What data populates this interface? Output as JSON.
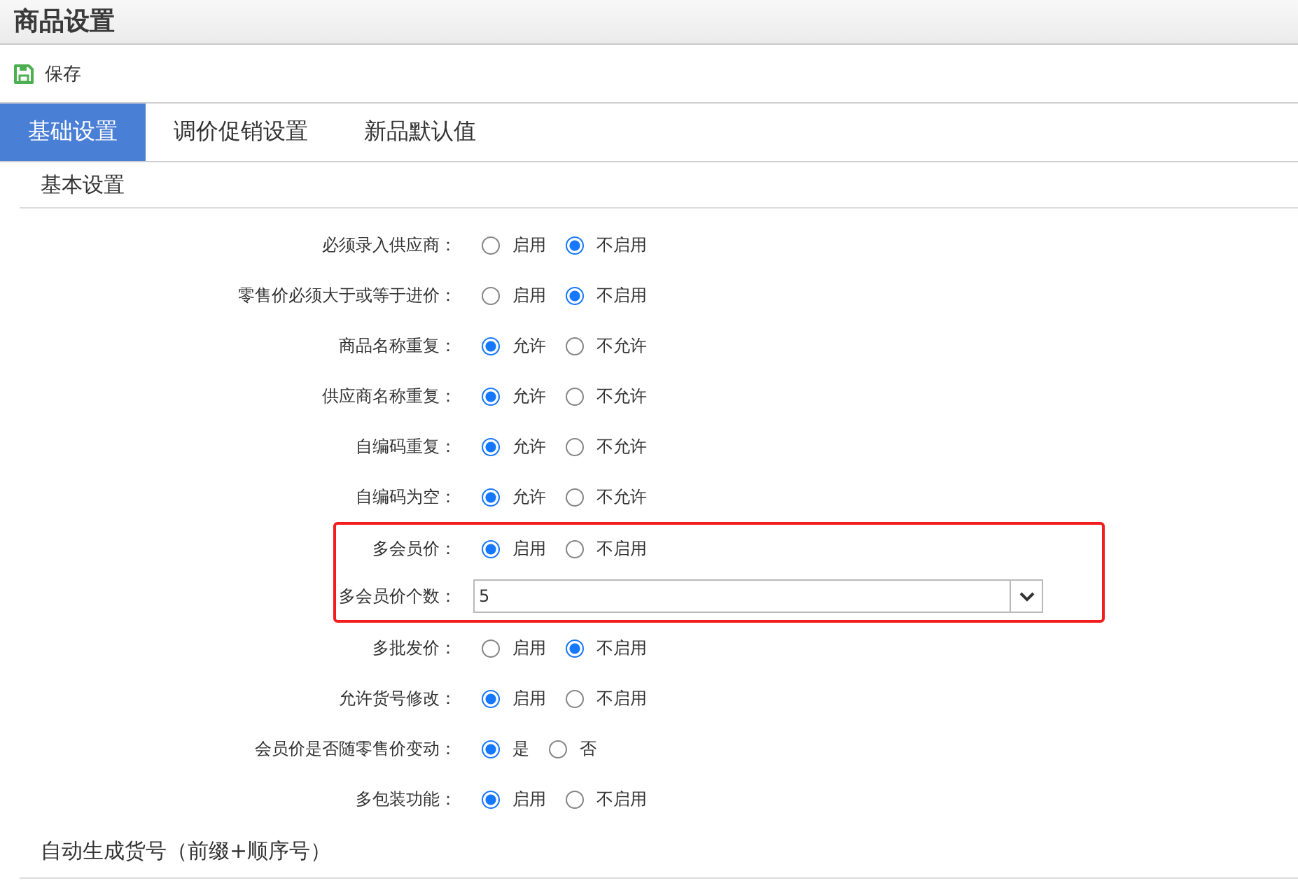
{
  "window": {
    "title": "商品设置"
  },
  "toolbar": {
    "save_button": {
      "label": "保存"
    }
  },
  "tabs": [
    {
      "label": "基础设置",
      "selected": true
    },
    {
      "label": "调价促销设置",
      "selected": false
    },
    {
      "label": "新品默认值",
      "selected": false
    }
  ],
  "sections": [
    {
      "title": "基本设置",
      "settings": [
        {
          "label": "必须录入供应商：",
          "kind": "radio",
          "options": [
            {
              "label": "启用",
              "selected": false
            },
            {
              "label": "不启用",
              "selected": true
            }
          ]
        },
        {
          "label": "零售价必须大于或等于进价：",
          "kind": "radio",
          "options": [
            {
              "label": "启用",
              "selected": false
            },
            {
              "label": "不启用",
              "selected": true
            }
          ]
        },
        {
          "label": "商品名称重复：",
          "kind": "radio",
          "options": [
            {
              "label": "允许",
              "selected": true
            },
            {
              "label": "不允许",
              "selected": false
            }
          ]
        },
        {
          "label": "供应商名称重复：",
          "kind": "radio",
          "options": [
            {
              "label": "允许",
              "selected": true
            },
            {
              "label": "不允许",
              "selected": false
            }
          ]
        },
        {
          "label": "自编码重复：",
          "kind": "radio",
          "options": [
            {
              "label": "允许",
              "selected": true
            },
            {
              "label": "不允许",
              "selected": false
            }
          ]
        },
        {
          "label": "自编码为空：",
          "kind": "radio",
          "options": [
            {
              "label": "允许",
              "selected": true
            },
            {
              "label": "不允许",
              "selected": false
            }
          ]
        },
        {
          "label": "多会员价：",
          "kind": "radio",
          "highlighted": true,
          "options": [
            {
              "label": "启用",
              "selected": true
            },
            {
              "label": "不启用",
              "selected": false
            }
          ]
        },
        {
          "label": "多会员价个数：",
          "kind": "select",
          "highlighted": true,
          "value": "5"
        },
        {
          "label": "多批发价：",
          "kind": "radio",
          "options": [
            {
              "label": "启用",
              "selected": false
            },
            {
              "label": "不启用",
              "selected": true
            }
          ]
        },
        {
          "label": "允许货号修改：",
          "kind": "radio",
          "options": [
            {
              "label": "启用",
              "selected": true
            },
            {
              "label": "不启用",
              "selected": false
            }
          ]
        },
        {
          "label": "会员价是否随零售价变动：",
          "kind": "radio",
          "options": [
            {
              "label": "是",
              "selected": true
            },
            {
              "label": "否",
              "selected": false
            }
          ]
        },
        {
          "label": "多包装功能：",
          "kind": "radio",
          "options": [
            {
              "label": "启用",
              "selected": true
            },
            {
              "label": "不启用",
              "selected": false
            }
          ]
        }
      ]
    },
    {
      "title": "自动生成货号（前缀+顺序号）"
    }
  ]
}
